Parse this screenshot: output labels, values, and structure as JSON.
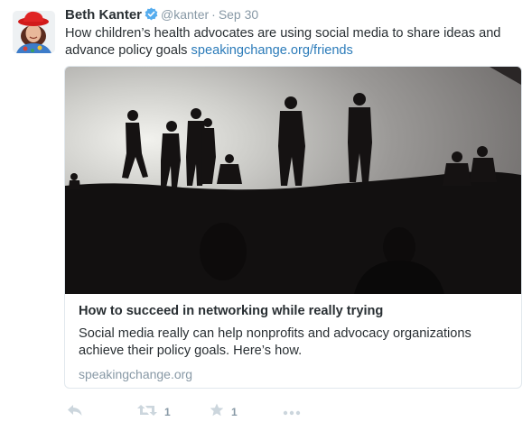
{
  "tweet": {
    "avatar_alt": "avatar",
    "fullname": "Beth Kanter",
    "username": "@kanter",
    "separator": "·",
    "time": "Sep 30",
    "text_line1": "How children’s health advocates are using social media to share ideas and",
    "text_line2_prefix": "advance policy goals ",
    "text_link": "speakingchange.org/friends"
  },
  "card": {
    "title": "How to succeed in networking while really trying",
    "description": "Social media really can help nonprofits and advocacy organizations achieve their policy goals. Here’s how.",
    "domain": "speakingchange.org"
  },
  "actions": {
    "retweet_count": "1",
    "favorite_count": "1"
  },
  "colors": {
    "link": "#2b7bb9",
    "muted": "#8899a6",
    "text": "#292f33",
    "verified": "#55acee",
    "icon": "#ccd6dd"
  }
}
